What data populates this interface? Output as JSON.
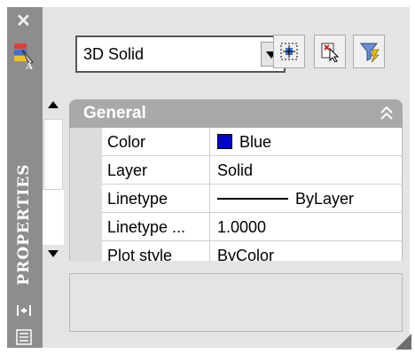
{
  "palette": {
    "title": "PROPERTIES"
  },
  "object_type": {
    "selected": "3D Solid"
  },
  "toolbar": {
    "buttons": [
      {
        "icon": "select-objects-icon"
      },
      {
        "icon": "toggle-pickadd-icon"
      },
      {
        "icon": "quick-select-icon"
      }
    ]
  },
  "category": {
    "label": "General",
    "collapse_icon": "double-chevron-up-icon"
  },
  "properties": [
    {
      "name": "Color",
      "value": "Blue",
      "swatch": "#0000cc"
    },
    {
      "name": "Layer",
      "value": "Solid"
    },
    {
      "name": "Linetype",
      "value": "ByLayer"
    },
    {
      "name": "Linetype ...",
      "value": "1.0000"
    },
    {
      "name": "Plot style",
      "value": "ByColor"
    }
  ]
}
